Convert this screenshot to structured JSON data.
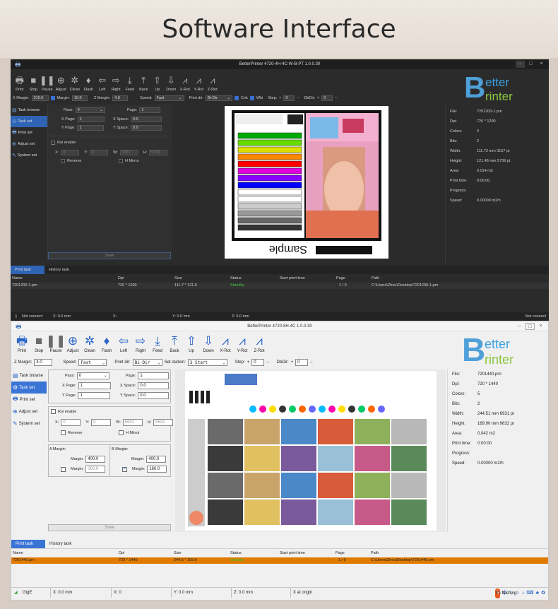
{
  "heading": "Software Interface",
  "logo": {
    "b": "B",
    "etter": "etter",
    "rinter": "rinter"
  },
  "win1": {
    "title": "BetterPrinter 4720-4H-4C-W-B-PT 1.0.0.30",
    "toolbar": [
      {
        "label": "Print",
        "icon": "printer-icon",
        "glyph": "🖶"
      },
      {
        "label": "Stop",
        "icon": "stop-icon",
        "glyph": "■"
      },
      {
        "label": "Pause",
        "icon": "pause-icon",
        "glyph": "❚❚"
      },
      {
        "label": "Adjust",
        "icon": "crosshair-icon",
        "glyph": "⊕"
      },
      {
        "label": "Clean",
        "icon": "bug-icon",
        "glyph": "✲"
      },
      {
        "label": "Flash",
        "icon": "drop-icon",
        "glyph": "♦"
      },
      {
        "label": "Left",
        "icon": "arrow-left-icon",
        "glyph": "⇦"
      },
      {
        "label": "Right",
        "icon": "arrow-right-icon",
        "glyph": "⇨"
      },
      {
        "label": "Feed",
        "icon": "feed-icon",
        "glyph": "⤓"
      },
      {
        "label": "Back",
        "icon": "back-icon",
        "glyph": "⤒"
      },
      {
        "label": "Up",
        "icon": "arrow-up-icon",
        "glyph": "⇧"
      },
      {
        "label": "Down",
        "icon": "arrow-down-icon",
        "glyph": "⇩"
      },
      {
        "label": "X-Rot",
        "icon": "x-rot-icon",
        "glyph": "⩘"
      },
      {
        "label": "Y-Rot",
        "icon": "y-rot-icon",
        "glyph": "⩘"
      },
      {
        "label": "Z-Rot",
        "icon": "z-rot-icon",
        "glyph": "⩘"
      }
    ],
    "options": {
      "x_margin_label": "X Margin:",
      "x_margin": "310.0",
      "margin_label": "Margin:",
      "margin": "10.0",
      "z_margin_label": "Z Margin:",
      "z_margin": "4.0",
      "speed_label": "Speed:",
      "speed": "Fast",
      "print_dir_label": "Print dir:",
      "print_dir": "Bi-Dir",
      "cok_label": "Cok",
      "whi_label": "Whi",
      "step_label": "Step:",
      "step": "0",
      "dbdir_label": "DbDir:",
      "dbdir": "0"
    },
    "nav": [
      {
        "label": "Task browse",
        "icon": "document-icon",
        "glyph": "▤"
      },
      {
        "label": "Task set",
        "icon": "gear-icon",
        "glyph": "⚙"
      },
      {
        "label": "Print set",
        "icon": "printer-icon",
        "glyph": "🖶"
      },
      {
        "label": "Adjust set",
        "icon": "adjust-icon",
        "glyph": "⊕"
      },
      {
        "label": "System set",
        "icon": "wrench-icon",
        "glyph": "✎"
      }
    ],
    "form": {
      "pass_label": "Pass:",
      "pass": "4",
      "page_label": "Page:",
      "page": "1",
      "x_page_label": "X Page:",
      "x_page": "1",
      "x_space_label": "X Space:",
      "x_space": "0.0",
      "y_page_label": "Y Page:",
      "y_page": "1",
      "y_space_label": "Y Space:",
      "y_space": "0.0",
      "roi_label": "Roi enable",
      "x_label": "X:",
      "x": "0",
      "y_label": "Y:",
      "y": "0",
      "w_label": "W:",
      "w": "3167",
      "h_label": "H:",
      "h": "5739",
      "reverse_label": "Reverse",
      "hmirror_label": "H Mirror",
      "save": "Save"
    },
    "preview": {
      "sample_text": "Sample"
    },
    "info": [
      {
        "k": "File:",
        "v": "7201200-1.prn"
      },
      {
        "k": "Dpi:",
        "v": "720 * 1200"
      },
      {
        "k": "Colors:",
        "v": "4"
      },
      {
        "k": "Bits:",
        "v": "2"
      },
      {
        "k": "Width:",
        "v": "111.72 mm   3167 pt"
      },
      {
        "k": "Height:",
        "v": "121.48 mm   5739 pt"
      },
      {
        "k": "Area:",
        "v": "0.014 m2"
      },
      {
        "k": "Print time:",
        "v": "0:00:00"
      },
      {
        "k": "Progress:",
        "v": ""
      },
      {
        "k": "Speed:",
        "v": "0.00000 m2/h"
      }
    ],
    "tabs": [
      "Print task",
      "History task"
    ],
    "columns": [
      "Name",
      "Dpi",
      "Size",
      "Status",
      "Start print time",
      "Page",
      "Path"
    ],
    "row": {
      "name": "7201200-1.prn",
      "dpi": "720 * 1200",
      "size": "111.7 * 121.5",
      "status": "Standby",
      "start": "",
      "page": "1 / 0",
      "path": "C:\\Users\\Zhou\\Desktop\\7201200-1.prn"
    },
    "status": {
      "conn": "Not connect",
      "x": "X: 0.0 mm",
      "x2": "X:",
      "y": "Y: 0.0 mm",
      "z": "Z: 0.0 mm",
      "right": "Not connect"
    }
  },
  "win2": {
    "title": "BetterPrinter 4720-8H-4C 1.0.0.30",
    "toolbar": [
      {
        "label": "Print",
        "icon": "printer-icon",
        "glyph": "🖶",
        "gray": false
      },
      {
        "label": "Stop",
        "icon": "stop-icon",
        "glyph": "■",
        "gray": true
      },
      {
        "label": "Pause",
        "icon": "pause-icon",
        "glyph": "❚❚",
        "gray": true
      },
      {
        "label": "Adjust",
        "icon": "crosshair-icon",
        "glyph": "⊕",
        "gray": false
      },
      {
        "label": "Clean",
        "icon": "bug-icon",
        "glyph": "✲",
        "gray": false
      },
      {
        "label": "Flash",
        "icon": "drop-icon",
        "glyph": "♦",
        "gray": false
      },
      {
        "label": "Left",
        "icon": "arrow-left-icon",
        "glyph": "⇦",
        "gray": false
      },
      {
        "label": "Right",
        "icon": "arrow-right-icon",
        "glyph": "⇨",
        "gray": false
      },
      {
        "label": "Feed",
        "icon": "feed-icon",
        "glyph": "⤓",
        "gray": false
      },
      {
        "label": "Back",
        "icon": "back-icon",
        "glyph": "⤒",
        "gray": false
      },
      {
        "label": "Up",
        "icon": "arrow-up-icon",
        "glyph": "⇧",
        "gray": false
      },
      {
        "label": "Down",
        "icon": "arrow-down-icon",
        "glyph": "⇩",
        "gray": false
      },
      {
        "label": "X-Rot",
        "icon": "x-rot-icon",
        "glyph": "⩘",
        "gray": false
      },
      {
        "label": "Y-Rot",
        "icon": "y-rot-icon",
        "glyph": "⩘",
        "gray": false
      },
      {
        "label": "Z-Rot",
        "icon": "z-rot-icon",
        "glyph": "⩘",
        "gray": false
      }
    ],
    "options": {
      "z_margin_label": "Z Margin:",
      "z_margin": "4.0",
      "speed_label": "Speed:",
      "speed": "Fast",
      "print_dir_label": "Print dir:",
      "print_dir": "Bi-Dir",
      "set_station_label": "Set station:",
      "set_station": "3 Start",
      "step_label": "Step:",
      "step": "0",
      "dbdir_label": "DbDir:",
      "dbdir": "0"
    },
    "nav": [
      {
        "label": "Task browse",
        "icon": "document-icon",
        "glyph": "▤"
      },
      {
        "label": "Task set",
        "icon": "gear-icon",
        "glyph": "⚙"
      },
      {
        "label": "Print set",
        "icon": "printer-icon",
        "glyph": "🖶"
      },
      {
        "label": "Adjust set",
        "icon": "adjust-icon",
        "glyph": "⊕"
      },
      {
        "label": "System set",
        "icon": "wrench-icon",
        "glyph": "✎"
      }
    ],
    "form": {
      "pass_label": "Pass:",
      "pass": "0",
      "page_label": "Page:",
      "page": "1",
      "x_page_label": "X Page:",
      "x_page": "1",
      "x_space_label": "X Space:",
      "x_space": "0.0",
      "y_page_label": "Y Page:",
      "y_page": "1",
      "y_space_label": "Y Space:",
      "y_space": "0.0",
      "roi_label": "Roi enable",
      "x_label": "X:",
      "x": "0",
      "y_label": "Y:",
      "y": "0",
      "w_label": "W:",
      "w": "6931",
      "h_label": "H:",
      "h": "9632",
      "reverse_label": "Reverse",
      "hmirror_label": "H Mirror",
      "a_margin_label": "A Margin:",
      "b_margin_label": "B Margin:",
      "margin_label": "Margin:",
      "a_margin1": "400.0",
      "a_margin2": "160.0",
      "b_margin1": "400.0",
      "b_margin2": "160.0",
      "save": "Save"
    },
    "info": [
      {
        "k": "File:",
        "v": "7201440.prn"
      },
      {
        "k": "Dpi:",
        "v": "720 * 1440"
      },
      {
        "k": "Colors:",
        "v": "5"
      },
      {
        "k": "Bits:",
        "v": "2"
      },
      {
        "k": "Width:",
        "v": "244.51 mm   6931 pt"
      },
      {
        "k": "Height:",
        "v": "169.90 mm   9632 pt"
      },
      {
        "k": "Area:",
        "v": "0.042 m2"
      },
      {
        "k": "Print time:",
        "v": "0:00:00"
      },
      {
        "k": "Progress:",
        "v": ""
      },
      {
        "k": "Speed:",
        "v": "0.00000 m2/h"
      }
    ],
    "tabs": [
      "Print task",
      "History task"
    ],
    "columns": [
      "Name",
      "Dpi",
      "Size",
      "Status",
      "Start print time",
      "Page",
      "Path"
    ],
    "row": {
      "name": "7201440.prn",
      "dpi": "720 * 1440",
      "size": "244.5 * 169.9",
      "status": "Standby",
      "start": "",
      "page": "1 / 0",
      "path": "C:\\Users\\Zhou\\Desktop\\7201440.prn"
    },
    "status": {
      "conn": "GigE",
      "x": "X: 0.0 mm",
      "x2": "X: 0",
      "y": "Y: 0.0 mm",
      "z": "Z: 0.0 mm",
      "origin": "X at origin",
      "right": "It's flashing"
    }
  }
}
